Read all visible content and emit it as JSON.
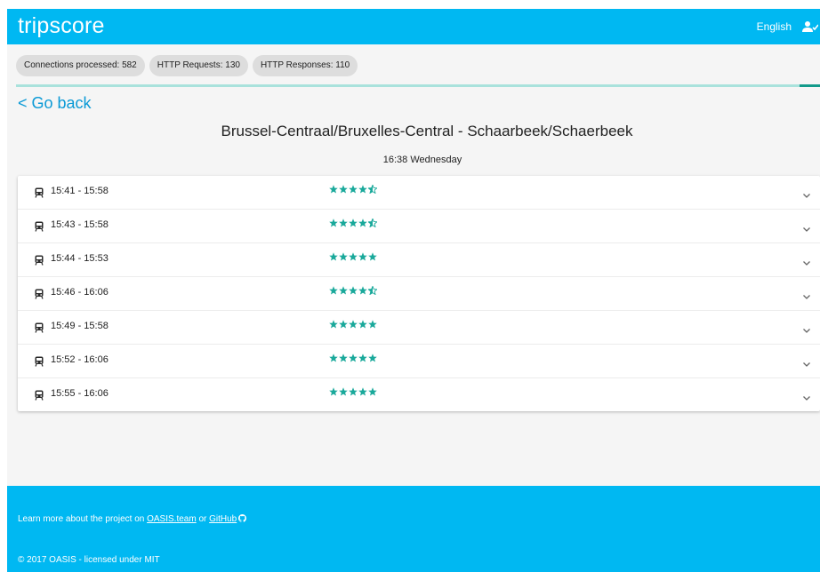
{
  "header": {
    "brand": "tripscore",
    "language": "English",
    "user_icon": "user-check-icon"
  },
  "stats": {
    "connections": "Connections processed: 582",
    "requests": "HTTP Requests: 130",
    "responses": "HTTP Responses: 110"
  },
  "progress": {
    "percent": 97.5,
    "track_color": "#a9e2dc",
    "fill_color": "#139a8a"
  },
  "nav": {
    "go_back": "< Go back"
  },
  "route": {
    "title": "Brussel-Centraal/Bruxelles-Central - Schaarbeek/Schaerbeek",
    "time": "16:38 Wednesday"
  },
  "trips": [
    {
      "time": "15:41 - 15:58",
      "rating": 4.5
    },
    {
      "time": "15:43 - 15:58",
      "rating": 4.5
    },
    {
      "time": "15:44 - 15:53",
      "rating": 5
    },
    {
      "time": "15:46 - 16:06",
      "rating": 4.5
    },
    {
      "time": "15:49 - 15:58",
      "rating": 5
    },
    {
      "time": "15:52 - 16:06",
      "rating": 5
    },
    {
      "time": "15:55 - 16:06",
      "rating": 5
    }
  ],
  "footer": {
    "learn_prefix": "Learn more about the project on ",
    "oasis_link": "OASIS.team",
    "or_text": " or ",
    "github_link": "GitHub",
    "copyright": "© 2017 OASIS - licensed under MIT"
  },
  "colors": {
    "brand": "#00b8f2",
    "link": "#0b9ad6",
    "star": "#1aa99b"
  }
}
